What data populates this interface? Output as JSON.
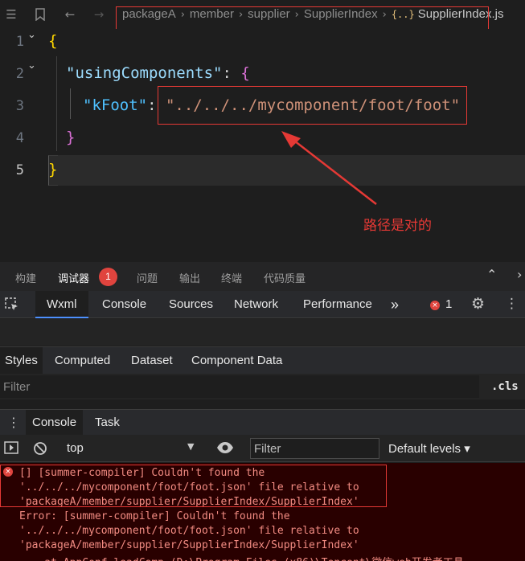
{
  "editor": {
    "breadcrumb": {
      "segments": [
        "packageA",
        "member",
        "supplier",
        "SupplierIndex"
      ],
      "file_icon": "{..}",
      "file": "SupplierIndex.js"
    },
    "lines": {
      "numbers": [
        "1",
        "2",
        "3",
        "4",
        "5"
      ],
      "l1_open": "{",
      "l2_key": "\"usingComponents\"",
      "l2_colon": ": ",
      "l2_open": "{",
      "l3_key": "\"kFoot\"",
      "l3_colon": ": ",
      "l3_value": "\"../../../mycomponent/foot/foot\"",
      "l4_close": "}",
      "l5_close": "}"
    },
    "annotation": "路径是对的"
  },
  "panel": {
    "tabs": [
      "构建",
      "调试器",
      "问题",
      "输出",
      "终端",
      "代码质量"
    ],
    "active_tab": "调试器",
    "badge": "1"
  },
  "devtools": {
    "tabs": [
      "Wxml",
      "Console",
      "Sources",
      "Network",
      "Performance"
    ],
    "more": "»",
    "error_count": "1",
    "error_glyph": "×"
  },
  "styles_pane": {
    "tabs": [
      "Styles",
      "Computed",
      "Dataset",
      "Component Data"
    ],
    "filter_placeholder": "Filter",
    "cls": ".cls"
  },
  "console": {
    "tabs": [
      "Console",
      "Task"
    ],
    "context": "top",
    "filter_placeholder": "Filter",
    "levels": "Default levels ▾",
    "lines": [
      "[] [summer-compiler] Couldn't found the",
      "'../../../mycomponent/foot/foot.json' file relative to",
      "'packageA/member/supplier/SupplierIndex/SupplierIndex'",
      "Error: [summer-compiler] Couldn't found the",
      "'../../../mycomponent/foot/foot.json' file relative to",
      "'packageA/member/supplier/SupplierIndex/SupplierIndex'",
      "    at AppConf.loadComp (D:\\Program Files (x86)\\Tencent\\微信web开发者工具"
    ]
  },
  "colors": {
    "annotation_red": "#e53935",
    "error_red": "#e0443e",
    "string": "#ce9178",
    "key": "#9cdcfe"
  }
}
